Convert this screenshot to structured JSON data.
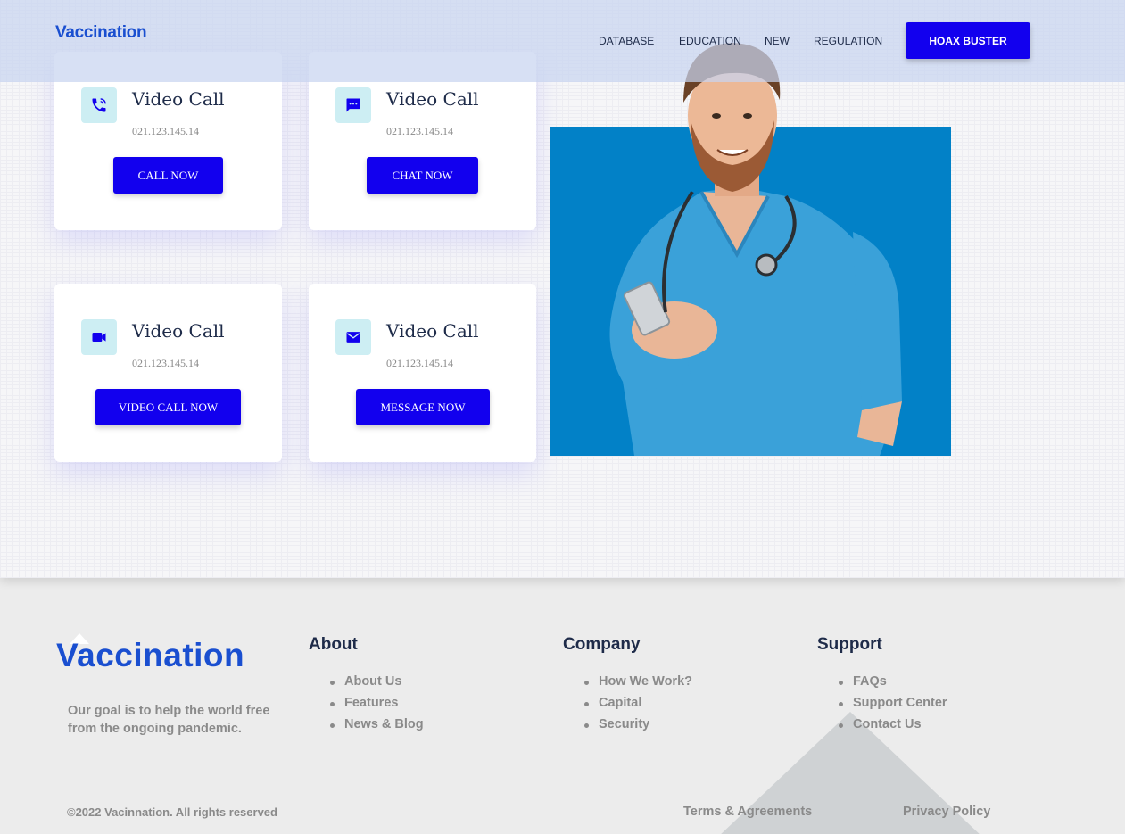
{
  "brand": {
    "name": "Vaccination"
  },
  "nav": {
    "links": [
      "DATABASE",
      "EDUCATION",
      "NEW",
      "REGULATION"
    ],
    "cta": "HOAX BUSTER"
  },
  "cards": [
    {
      "title": "Video Call",
      "phone": "021.123.145.14",
      "button": "CALL NOW",
      "icon": "phone-icon"
    },
    {
      "title": "Video Call",
      "phone": "021.123.145.14",
      "button": "CHAT NOW",
      "icon": "chat-icon"
    },
    {
      "title": "Video Call",
      "phone": "021.123.145.14",
      "button": "VIDEO CALL NOW",
      "icon": "video-camera-icon"
    },
    {
      "title": "Video Call",
      "phone": "021.123.145.14",
      "button": "MESSAGE NOW",
      "icon": "envelope-icon"
    }
  ],
  "colors": {
    "accent": "#1200ee",
    "brand": "#1a4fd0",
    "photo_bg": "#0281c7",
    "icon_bg": "#cdeef3"
  },
  "footer": {
    "tagline": "Our goal is to help the world free from the ongoing pandemic.",
    "about": {
      "heading": "About",
      "items": [
        "About Us",
        "Features",
        "News & Blog"
      ]
    },
    "company": {
      "heading": "Company",
      "items": [
        "How We Work?",
        "Capital",
        "Security"
      ]
    },
    "support": {
      "heading": "Support",
      "items": [
        "FAQs",
        "Support Center",
        "Contact Us"
      ]
    },
    "copyright": "©2022 Vacinnation. All rights reserved",
    "terms": "Terms & Agreements",
    "privacy": "Privacy Policy"
  }
}
